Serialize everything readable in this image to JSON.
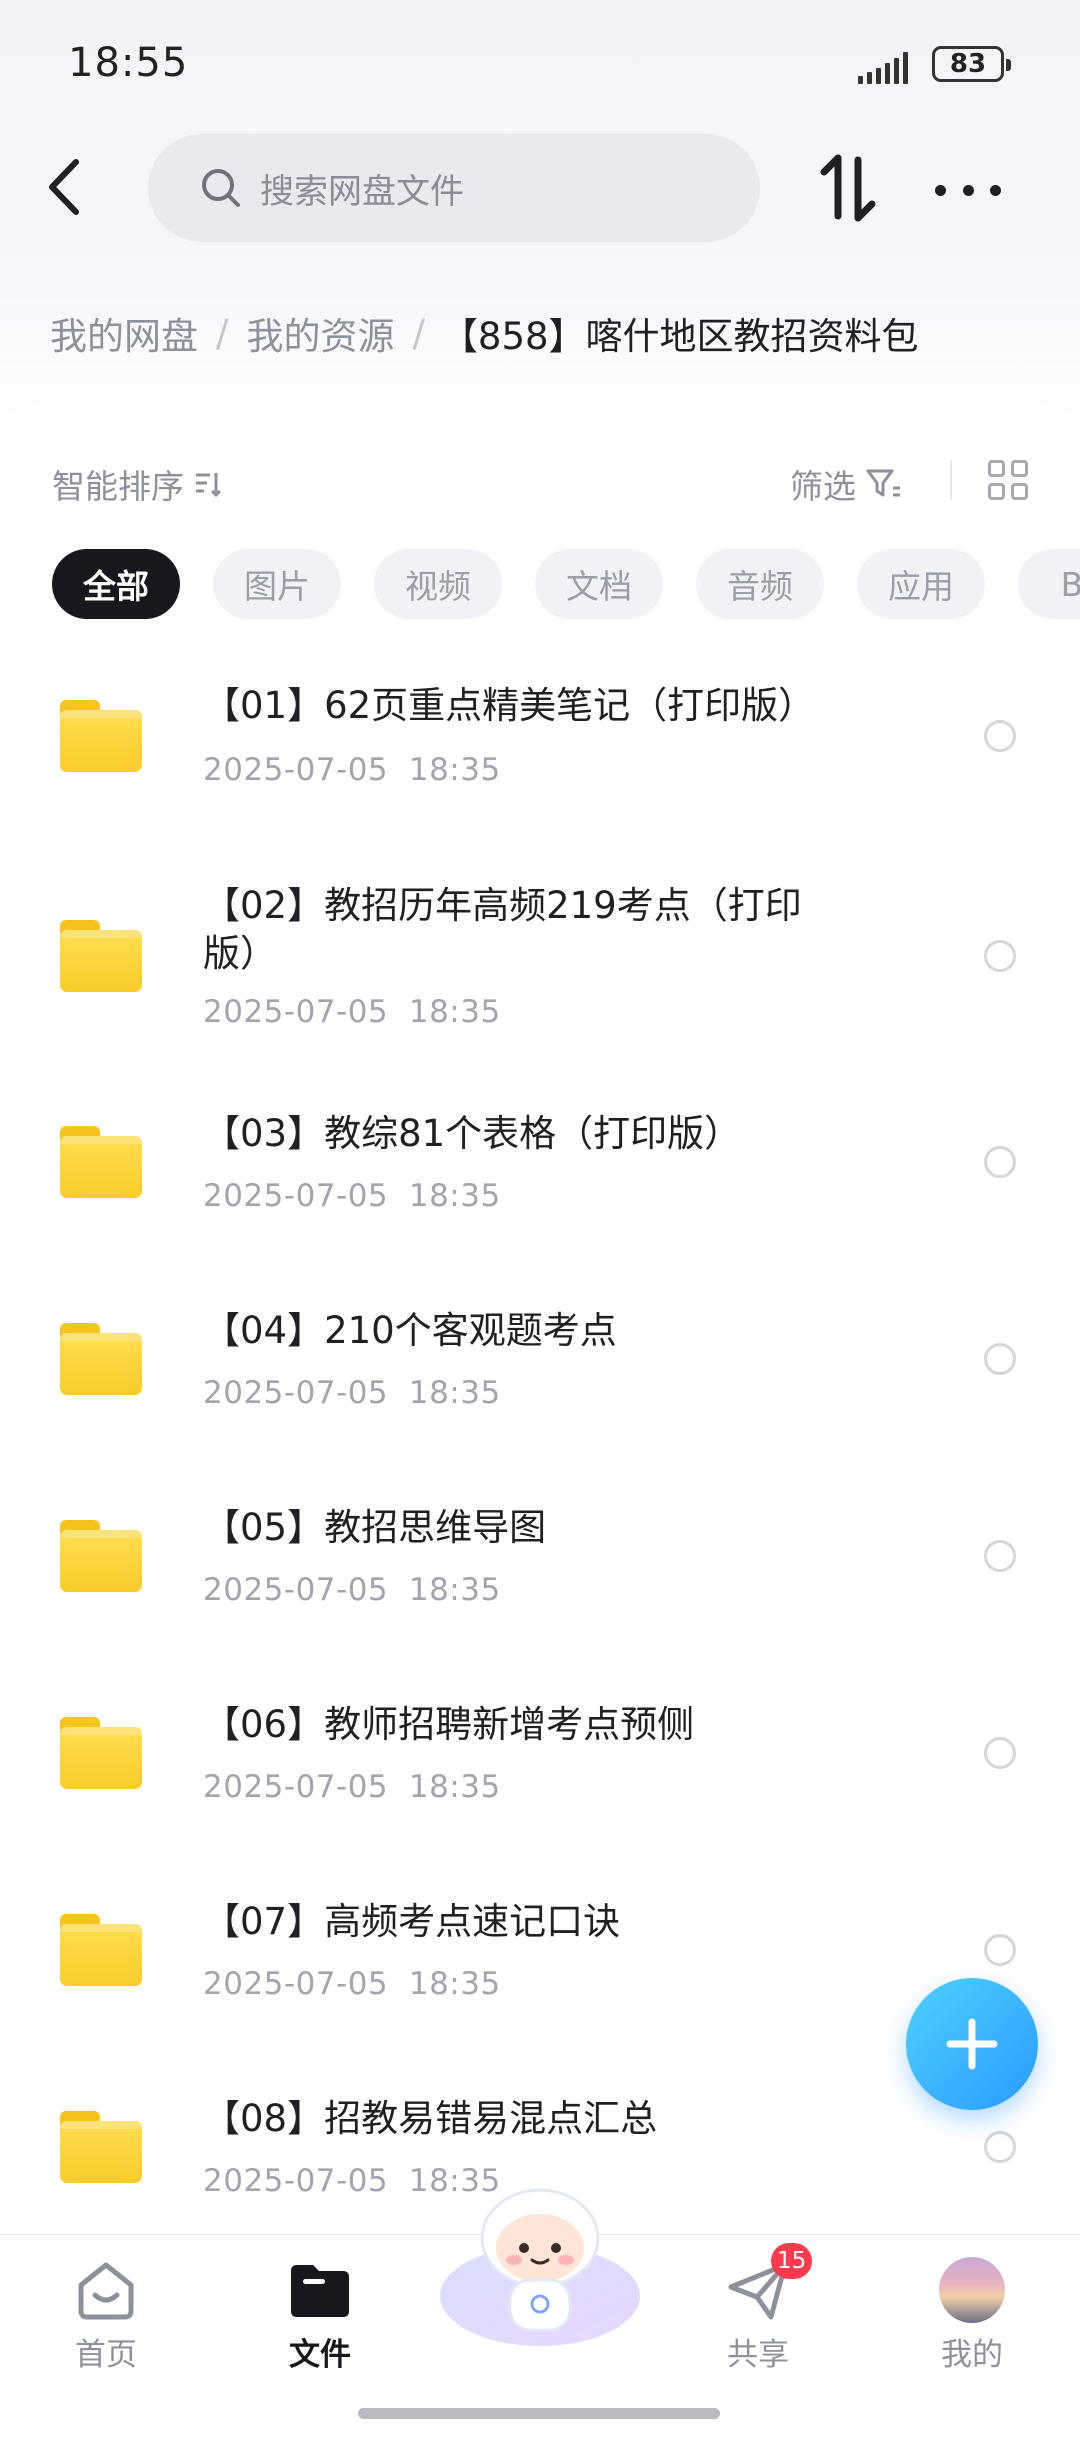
{
  "status_bar": {
    "time": "18:55",
    "battery": "83"
  },
  "header": {
    "back_icon": "chevron-left-icon",
    "search_placeholder": "搜索网盘文件",
    "sort_icon": "sort-arrows-icon",
    "more_icon": "more-dots-icon"
  },
  "breadcrumb": {
    "items": [
      "我的网盘",
      "我的资源"
    ],
    "separator": "/",
    "current": "【858】喀什地区教招资料包"
  },
  "toolbar": {
    "sort_label": "智能排序",
    "filter_label": "筛选"
  },
  "chips": [
    "全部",
    "图片",
    "视频",
    "文档",
    "音频",
    "应用",
    "BT"
  ],
  "files": [
    {
      "title": "【01】62页重点精美笔记（打印版）",
      "date": "2025-07-05  18:35"
    },
    {
      "title": "【02】教招历年高频219考点（打印版）",
      "date": "2025-07-05  18:35"
    },
    {
      "title": "【03】教综81个表格（打印版）",
      "date": "2025-07-05  18:35"
    },
    {
      "title": "【04】210个客观题考点",
      "date": "2025-07-05  18:35"
    },
    {
      "title": "【05】教招思维导图",
      "date": "2025-07-05  18:35"
    },
    {
      "title": "【06】教师招聘新增考点预侧",
      "date": "2025-07-05  18:35"
    },
    {
      "title": "【07】高频考点速记口诀",
      "date": "2025-07-05  18:35"
    },
    {
      "title": "【08】招教易错易混点汇总",
      "date": "2025-07-05  18:35"
    }
  ],
  "bottom_nav": {
    "home": "首页",
    "files": "文件",
    "share": "共享",
    "share_badge": "15",
    "me": "我的"
  },
  "colors": {
    "accent": "#2a9bff",
    "folder": "#f9cc29",
    "badge": "#ff3a4d",
    "active_chip": "#16181d"
  }
}
